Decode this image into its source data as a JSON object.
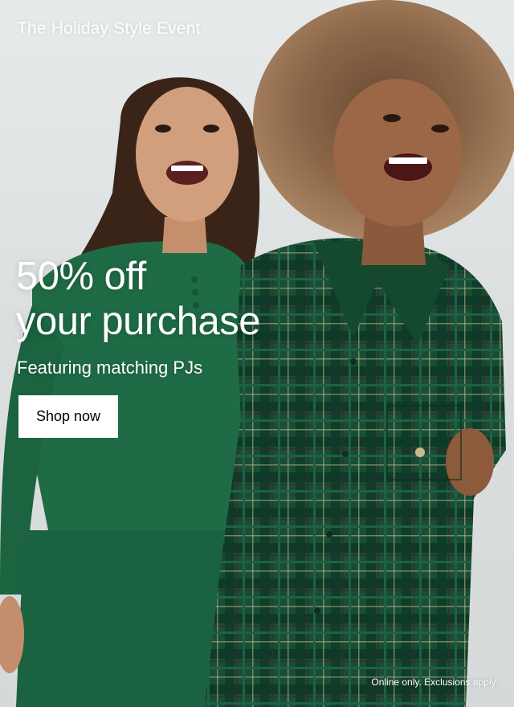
{
  "promo": {
    "eyebrow": "The Holiday Style Event",
    "headline_line1": "50% off",
    "headline_line2": "your purchase",
    "subhead": "Featuring matching PJs",
    "cta_label": "Shop now",
    "disclaimer": "Online only. Exclusions apply."
  },
  "colors": {
    "text": "#ffffff",
    "cta_background": "#ffffff",
    "cta_text": "#000000",
    "solid_pajama_green": "#1f6b45",
    "plaid_pajama_green": "#174f36"
  }
}
